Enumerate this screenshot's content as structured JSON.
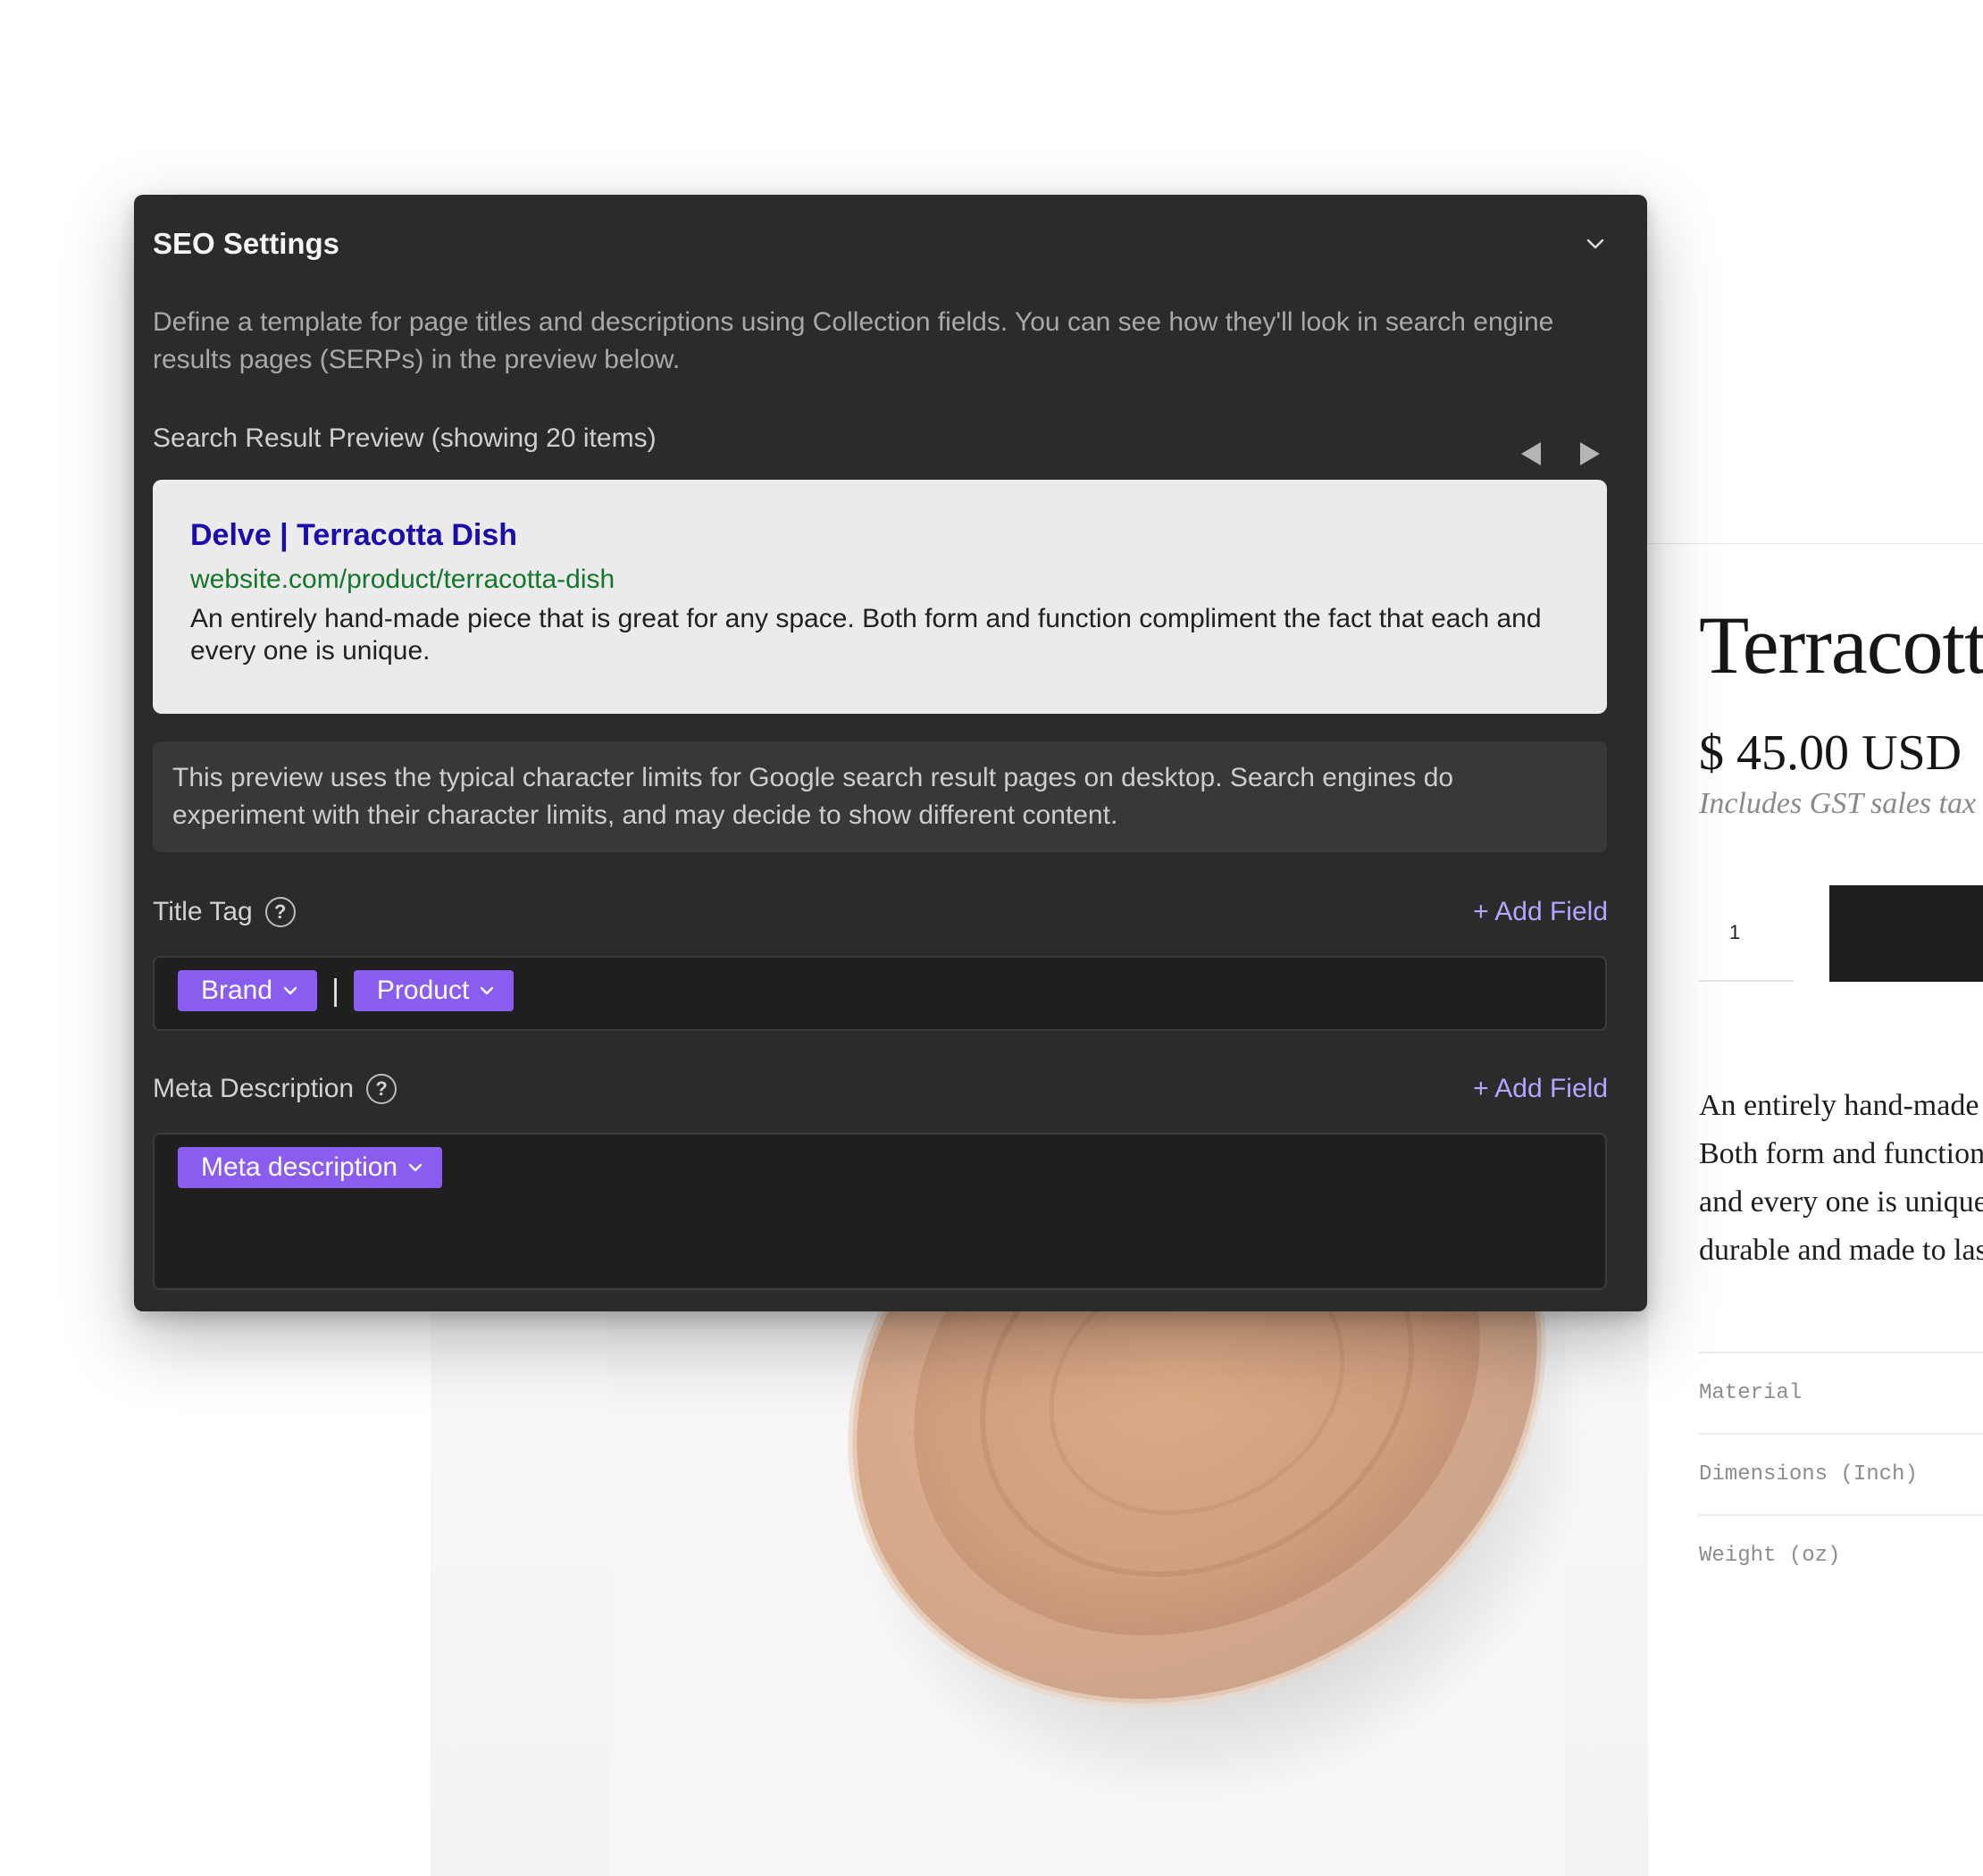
{
  "seo": {
    "title": "SEO Settings",
    "intro": "Define a template for page titles and descriptions using Collection fields. You can see how they'll look in search engine results pages (SERPs) in the preview below.",
    "preview_label": "Search Result Preview (showing 20 items)",
    "serp": {
      "title": "Delve | Terracotta Dish",
      "url": "website.com/product/terracotta-dish",
      "description": "An entirely hand-made piece that is great for any space. Both form and function compliment the fact that each and every one is unique."
    },
    "notice": "This preview uses the typical character limits for Google search result pages on desktop. Search engines do experiment with their character limits, and may decide to show different content.",
    "title_tag": {
      "label": "Title Tag",
      "help": "?",
      "add_field": "+ Add Field",
      "tokens": [
        "Brand",
        "Product"
      ],
      "separator": "|"
    },
    "meta_description": {
      "label": "Meta Description",
      "help": "?",
      "add_field": "+ Add Field",
      "tokens": [
        "Meta description"
      ]
    }
  },
  "product": {
    "title": "Terracotta Dish",
    "price": "$ 45.00 USD",
    "tax_note": "Includes GST sales tax",
    "quantity": "1",
    "description_lines": [
      "An entirely hand-made piece that is great for any space.",
      "Both form and function compliment the fact that each",
      "and every one is unique. Each piece is",
      "durable and made to last."
    ],
    "specs": [
      "Material",
      "Dimensions (Inch)",
      "Weight (oz)"
    ]
  },
  "colors": {
    "panel_bg": "#2b2b2b",
    "token_bg": "#8a5cf0",
    "link_accent": "#b7a4ff",
    "serp_title": "#1a0dab",
    "serp_url": "#14762b",
    "dish": "#d6a88a"
  },
  "icons": {
    "collapse": "chevron-down-icon",
    "prev": "triangle-left-icon",
    "next": "triangle-right-icon",
    "help": "question-circle-icon",
    "token_dropdown": "chevron-down-icon"
  }
}
